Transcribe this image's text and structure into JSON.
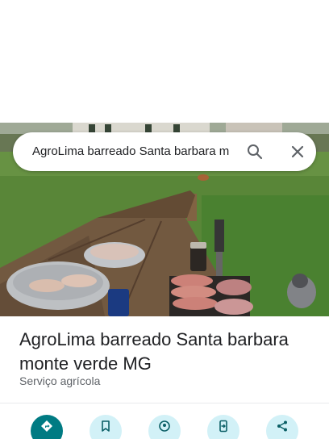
{
  "search": {
    "query": "AgroLima barreado Santa barbara m",
    "search_icon": "search-icon",
    "clear_icon": "close-icon"
  },
  "place": {
    "name": "AgroLima barreado Santa barbara monte verde MG",
    "category": "Serviço agrícola"
  },
  "actions": [
    {
      "icon": "directions-icon",
      "style": "primary"
    },
    {
      "icon": "bookmark-icon"
    },
    {
      "icon": "nearby-icon"
    },
    {
      "icon": "send-to-phone-icon"
    },
    {
      "icon": "share-icon"
    }
  ],
  "colors": {
    "primary": "#007b83",
    "action_bg": "#d2f1f7",
    "text": "#202124",
    "secondary_text": "#5f6368"
  }
}
